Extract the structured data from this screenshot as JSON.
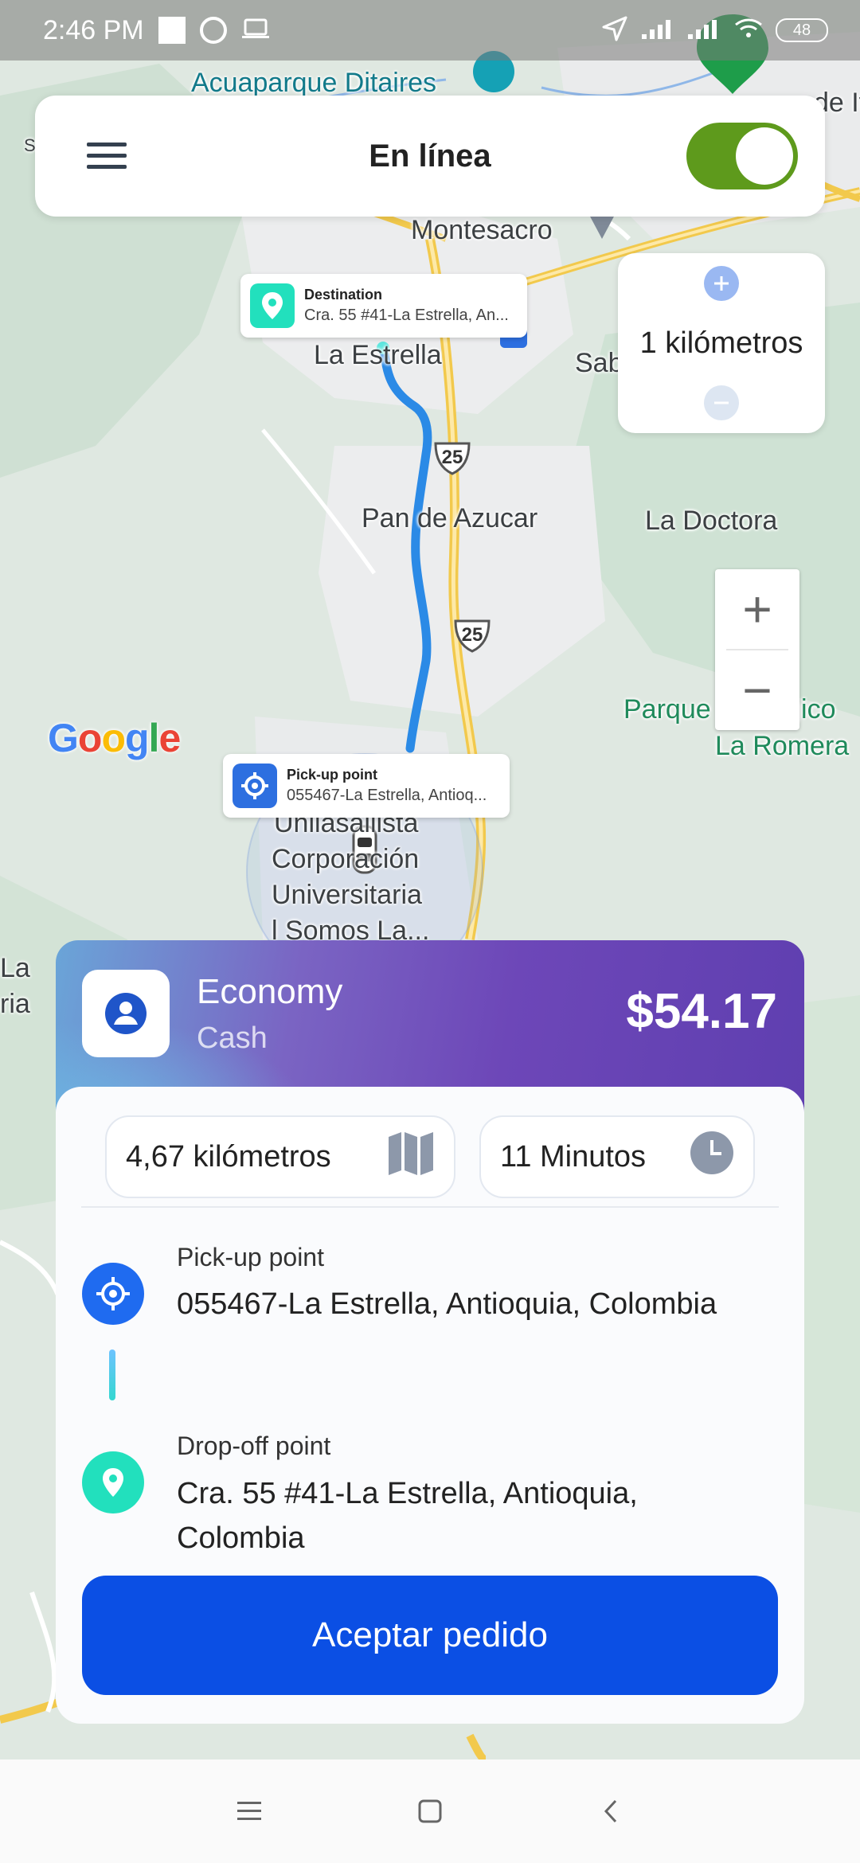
{
  "status_bar": {
    "time": "2:46 PM",
    "battery": "48"
  },
  "top_card": {
    "title": "En línea",
    "online": true
  },
  "radius": {
    "label": "1 kilómetros"
  },
  "map": {
    "labels": {
      "acuaparque": "Acuaparque Ditaires",
      "montesacro": "Montesacro",
      "la_estrella": "La Estrella",
      "sab": "Sab",
      "pan_de_azucar": "Pan de Azucar",
      "la_doctora": "La Doctora",
      "parque_ecologico": "Parque Ecologico",
      "la_romera": "La Romera",
      "unilasallista": "Unilasallista",
      "corporacion": "Corporación",
      "universitaria": "Universitaria",
      "somos": "l Somos La...",
      "la_left": "La",
      "ria_left": "ria",
      "de_it": "de It",
      "s_left": "S"
    },
    "route_shields": [
      "25",
      "25"
    ],
    "google": "Google",
    "zoom_in": "+",
    "zoom_out": "−",
    "destination_marker": {
      "title": "Destination",
      "address": "Cra. 55 #41-La Estrella, An..."
    },
    "pickup_marker": {
      "title": "Pick-up point",
      "address": "055467-La Estrella, Antioq..."
    }
  },
  "order": {
    "service": "Economy",
    "payment": "Cash",
    "price": "$54.17",
    "distance": "4,67 kilómetros",
    "duration": "11 Minutos",
    "pickup_label": "Pick-up point",
    "pickup_address": "055467-La Estrella, Antioquia, Colombia",
    "dropoff_label": "Drop-off point",
    "dropoff_address": "Cra. 55 #41-La Estrella, Antioquia, Colombia",
    "accept_label": "Aceptar pedido"
  },
  "colors": {
    "accent": "#0b4fe4",
    "toggle_on": "#5e9a1c",
    "route": "#2b8ae6",
    "pickup": "#1f6bf0",
    "dropoff": "#22e0bd"
  }
}
